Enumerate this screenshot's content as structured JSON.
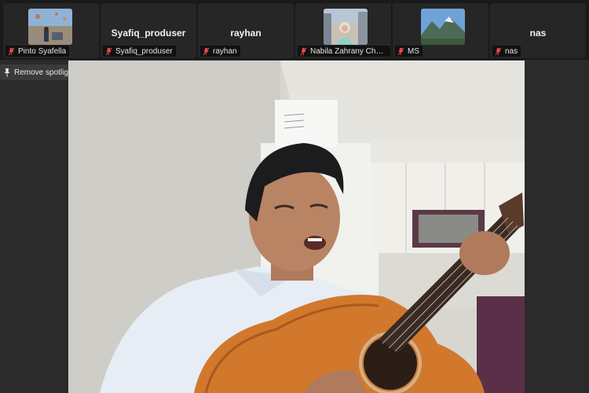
{
  "participants": [
    {
      "label": "Pinto Syafella",
      "big_name": "",
      "has_video": true
    },
    {
      "label": "Syafiq_produser",
      "big_name": "Syafiq_produser",
      "has_video": false
    },
    {
      "label": "rayhan",
      "big_name": "rayhan",
      "has_video": false
    },
    {
      "label": "Nabila Zahrany Choir...",
      "big_name": "",
      "has_video": true
    },
    {
      "label": "MS",
      "big_name": "",
      "has_video": true
    },
    {
      "label": "nas",
      "big_name": "nas",
      "has_video": false
    }
  ],
  "spotlight": {
    "button_label": "Remove spotlight",
    "icon": "pin-icon"
  },
  "colors": {
    "muted_mic": "#e5484d",
    "strip_bg": "#1a1a1a",
    "page_bg": "#2b2b2b"
  }
}
